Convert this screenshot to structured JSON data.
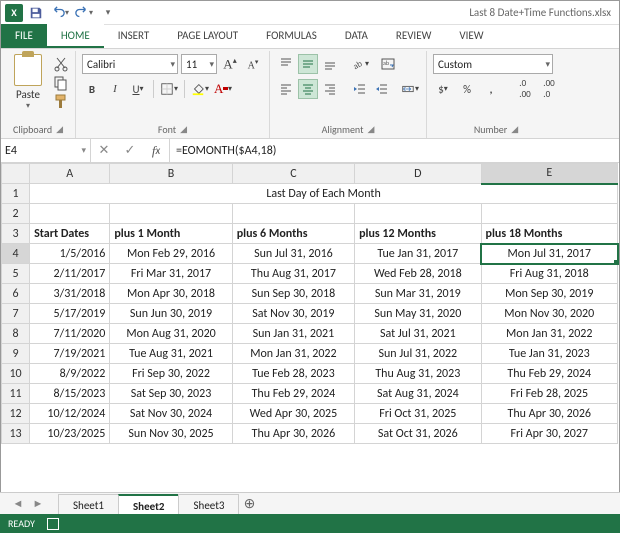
{
  "titlebar": {
    "filename": "Last 8 Date+Time Functions.xlsx"
  },
  "ribbon": {
    "tabs": {
      "file": "FILE",
      "home": "HOME",
      "insert": "INSERT",
      "pagelayout": "PAGE LAYOUT",
      "formulas": "FORMULAS",
      "data": "DATA",
      "review": "REVIEW",
      "view": "VIEW"
    },
    "clipboard": {
      "paste": "Paste",
      "label": "Clipboard"
    },
    "font": {
      "name": "Calibri",
      "size": "11",
      "label": "Font"
    },
    "alignment": {
      "label": "Alignment"
    },
    "number": {
      "format": "Custom",
      "label": "Number"
    }
  },
  "formula_bar": {
    "namebox": "E4",
    "formula": "=EOMONTH($A4,18)"
  },
  "sheet": {
    "columns": [
      "A",
      "B",
      "C",
      "D",
      "E"
    ],
    "title": "Last Day of Each Month",
    "headers": {
      "a": "Start Dates",
      "b": "plus 1 Month",
      "c": "plus 6 Months",
      "d": "plus 12 Months",
      "e": "plus 18 Months"
    },
    "rows": [
      {
        "n": "4",
        "a": "1/5/2016",
        "b": "Mon Feb 29, 2016",
        "c": "Sun Jul 31, 2016",
        "d": "Tue Jan 31, 2017",
        "e": "Mon Jul 31, 2017"
      },
      {
        "n": "5",
        "a": "2/11/2017",
        "b": "Fri Mar 31, 2017",
        "c": "Thu Aug 31, 2017",
        "d": "Wed Feb 28, 2018",
        "e": "Fri Aug 31, 2018"
      },
      {
        "n": "6",
        "a": "3/31/2018",
        "b": "Mon Apr 30, 2018",
        "c": "Sun Sep 30, 2018",
        "d": "Sun Mar 31, 2019",
        "e": "Mon Sep 30, 2019"
      },
      {
        "n": "7",
        "a": "5/17/2019",
        "b": "Sun Jun 30, 2019",
        "c": "Sat Nov 30, 2019",
        "d": "Sun May 31, 2020",
        "e": "Mon Nov 30, 2020"
      },
      {
        "n": "8",
        "a": "7/11/2020",
        "b": "Mon Aug 31, 2020",
        "c": "Sun Jan 31, 2021",
        "d": "Sat Jul 31, 2021",
        "e": "Mon Jan 31, 2022"
      },
      {
        "n": "9",
        "a": "7/19/2021",
        "b": "Tue Aug 31, 2021",
        "c": "Mon Jan 31, 2022",
        "d": "Sun Jul 31, 2022",
        "e": "Tue Jan 31, 2023"
      },
      {
        "n": "10",
        "a": "8/9/2022",
        "b": "Fri Sep 30, 2022",
        "c": "Tue Feb 28, 2023",
        "d": "Thu Aug 31, 2023",
        "e": "Thu Feb 29, 2024"
      },
      {
        "n": "11",
        "a": "8/15/2023",
        "b": "Sat Sep 30, 2023",
        "c": "Thu Feb 29, 2024",
        "d": "Sat Aug 31, 2024",
        "e": "Fri Feb 28, 2025"
      },
      {
        "n": "12",
        "a": "10/12/2024",
        "b": "Sat Nov 30, 2024",
        "c": "Wed Apr 30, 2025",
        "d": "Fri Oct 31, 2025",
        "e": "Thu Apr 30, 2026"
      },
      {
        "n": "13",
        "a": "10/23/2025",
        "b": "Sun Nov 30, 2025",
        "c": "Thu Apr 30, 2026",
        "d": "Sat Oct 31, 2026",
        "e": "Fri Apr 30, 2027"
      }
    ]
  },
  "tabs": {
    "s1": "Sheet1",
    "s2": "Sheet2",
    "s3": "Sheet3"
  },
  "status": {
    "ready": "READY"
  }
}
